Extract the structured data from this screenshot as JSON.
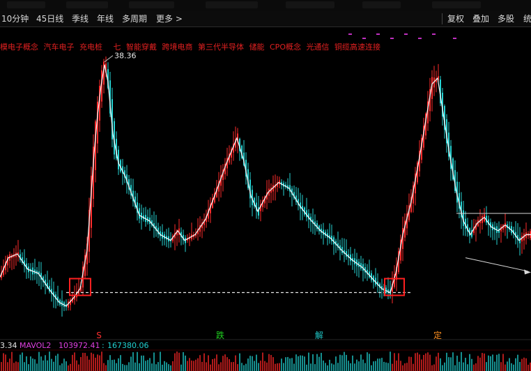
{
  "toolbar": {
    "left": [
      "10分钟",
      "45日线",
      "季线",
      "年线",
      "多周期",
      "更多 >"
    ],
    "right": [
      "复权",
      "叠加",
      "多股",
      "统"
    ]
  },
  "concepts": [
    "模电子概念",
    "汽车电子",
    "充电桩",
    "七",
    "智能穿戴",
    "跨境电商",
    "第三代半导体",
    "储能",
    "CPO概念",
    "光通信",
    "铜缆高速连接"
  ],
  "chart_data": {
    "type": "line",
    "title": "",
    "peak_label": "38.36",
    "x": [
      0,
      12,
      25,
      40,
      55,
      70,
      85,
      95,
      105,
      115,
      125,
      130,
      135,
      140,
      145,
      150,
      155,
      162,
      170,
      180,
      190,
      200,
      215,
      230,
      245,
      255,
      265,
      280,
      295,
      310,
      325,
      340,
      350,
      360,
      370,
      385,
      400,
      415,
      430,
      445,
      460,
      475,
      490,
      505,
      520,
      535,
      548,
      560,
      568,
      578,
      590,
      600,
      610,
      620,
      628,
      635,
      645,
      655,
      665,
      675,
      685,
      695,
      705,
      715,
      725,
      735,
      745,
      755,
      762
    ],
    "values": [
      26.6,
      27.6,
      27.8,
      27.0,
      26.8,
      26.0,
      25.3,
      25.1,
      25.5,
      26.0,
      28.0,
      30.5,
      33.0,
      35.0,
      36.5,
      37.6,
      36.7,
      34.0,
      32.5,
      31.8,
      30.8,
      29.8,
      29.5,
      28.8,
      28.5,
      29.0,
      28.5,
      28.8,
      29.6,
      31.0,
      32.5,
      33.8,
      32.6,
      30.8,
      30.0,
      31.0,
      31.5,
      31.2,
      30.3,
      29.6,
      29.0,
      28.6,
      28.0,
      27.5,
      27.1,
      26.5,
      26.0,
      25.8,
      26.8,
      28.8,
      30.5,
      32.4,
      34.5,
      36.6,
      36.9,
      35.3,
      33.0,
      31.0,
      29.5,
      28.8,
      29.4,
      29.7,
      29.2,
      29.0,
      29.3,
      29.0,
      28.5,
      28.8,
      28.8
    ],
    "ylim": [
      24.7,
      38.6
    ],
    "dashed_level": 25.8,
    "markers": [
      {
        "x": 142,
        "text": "S",
        "color": "#ff3030"
      },
      {
        "x": 316,
        "text": "跌",
        "color": "#20d020"
      },
      {
        "x": 458,
        "text": "解",
        "color": "#20c8c8"
      },
      {
        "x": 628,
        "text": "定",
        "color": "#ff9020"
      }
    ],
    "volume_indicator": {
      "fragment": "3.34",
      "name": "MAVOL2",
      "value": "103972.41",
      "sep": ":",
      "value2": "167380.06"
    }
  }
}
